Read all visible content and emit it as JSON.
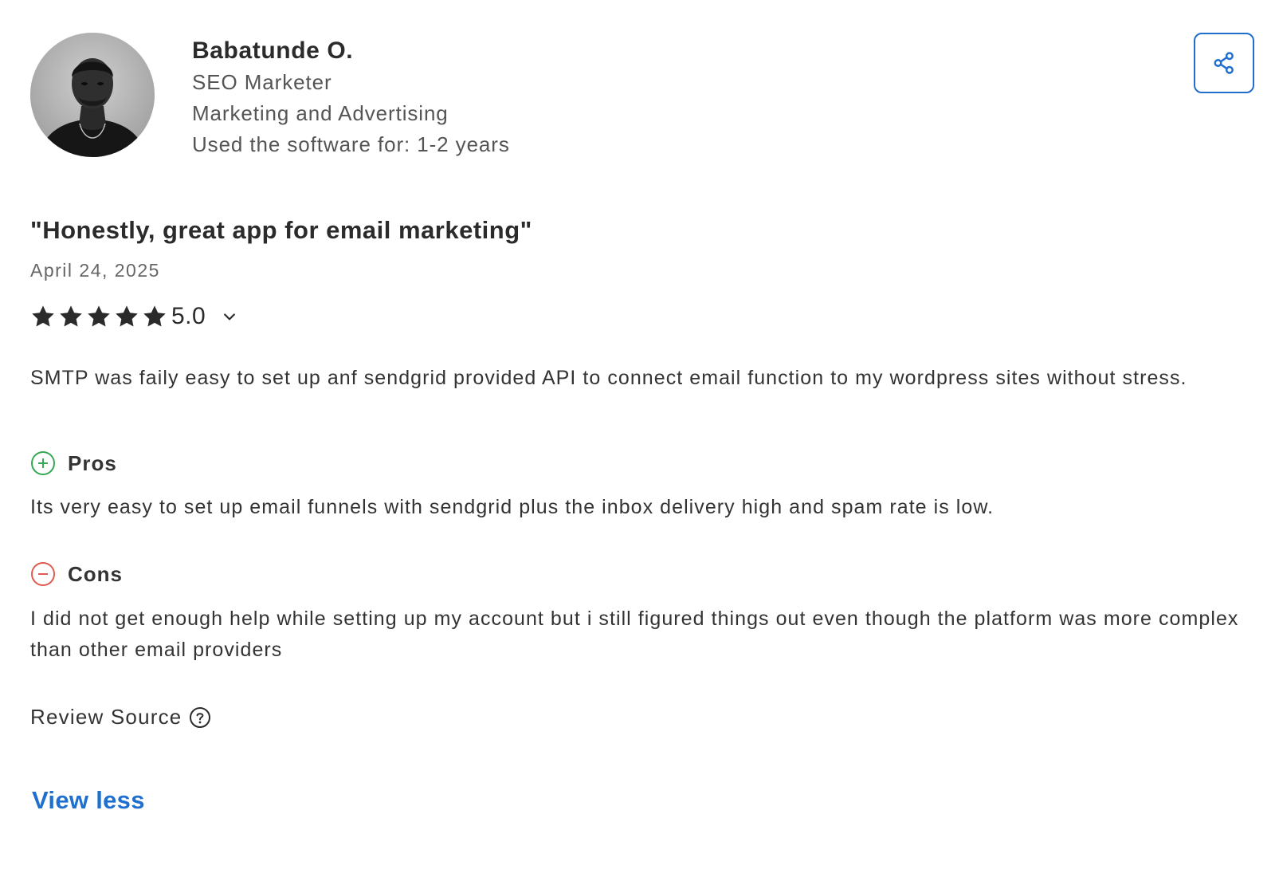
{
  "reviewer": {
    "name": "Babatunde O.",
    "role": "SEO Marketer",
    "industry": "Marketing and Advertising",
    "usage": "Used the software for: 1-2 years",
    "avatar_icon": "reviewer-photo"
  },
  "share": {
    "icon": "share-icon",
    "color": "#1f6fcf"
  },
  "review": {
    "title": "\"Honestly, great app for email marketing\"",
    "date": "April 24, 2025",
    "rating": {
      "value_label": "5.0",
      "stars": 5,
      "max_stars": 5,
      "toggle_icon": "chevron-down-icon"
    },
    "summary": "SMTP was faily easy to set up anf sendgrid provided API to connect email function to my wordpress sites without stress.",
    "pros": {
      "label": "Pros",
      "icon": "plus-circle-icon",
      "color": "#34a853",
      "text": "Its very easy to set up email funnels with sendgrid plus the inbox delivery high and spam rate is low."
    },
    "cons": {
      "label": "Cons",
      "icon": "minus-circle-icon",
      "color": "#e05a4f",
      "text": "I did not get enough help while setting up my account but i still figured things out even though the platform was more complex than other email providers"
    }
  },
  "review_source": {
    "label": "Review Source",
    "icon": "question-circle-icon"
  },
  "view_less": {
    "label": "View less",
    "color": "#1f6fcf"
  }
}
